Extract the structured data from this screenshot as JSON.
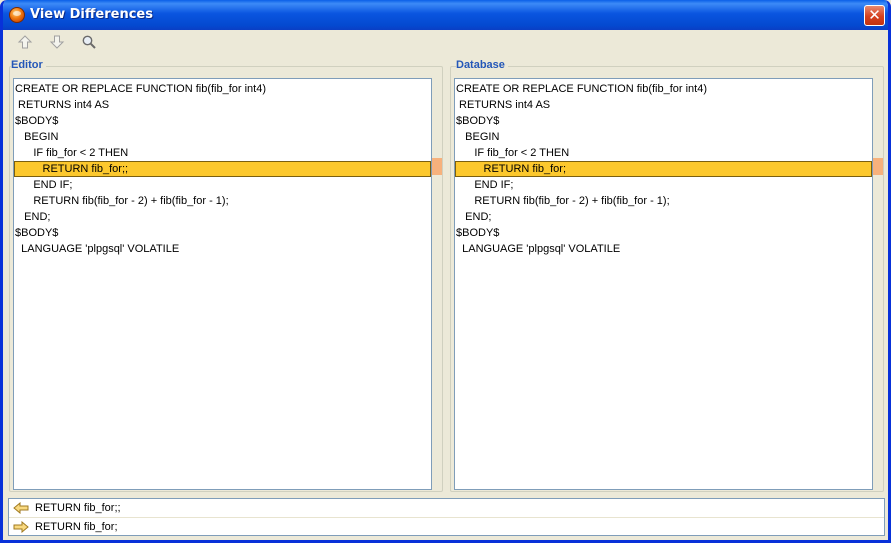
{
  "window": {
    "title": "View Differences",
    "close_label": "✕"
  },
  "toolbar": {
    "buttons": [
      {
        "name": "previous-difference-button",
        "icon": "arrow-up-icon"
      },
      {
        "name": "next-difference-button",
        "icon": "arrow-down-icon"
      },
      {
        "name": "find-button",
        "icon": "magnifier-icon"
      }
    ]
  },
  "editor": {
    "label": "Editor",
    "lines": [
      "CREATE OR REPLACE FUNCTION fib(fib_for int4)",
      " RETURNS int4 AS",
      "$BODY$",
      "   BEGIN",
      "      IF fib_for < 2 THEN",
      "         RETURN fib_for;;",
      "      END IF;",
      "      RETURN fib(fib_for - 2) + fib(fib_for - 1);",
      "   END;",
      "$BODY$",
      "  LANGUAGE 'plpgsql' VOLATILE"
    ]
  },
  "database": {
    "label": "Database",
    "lines": [
      "CREATE OR REPLACE FUNCTION fib(fib_for int4)",
      " RETURNS int4 AS",
      "$BODY$",
      "   BEGIN",
      "      IF fib_for < 2 THEN",
      "         RETURN fib_for;",
      "      END IF;",
      "      RETURN fib(fib_for - 2) + fib(fib_for - 1);",
      "   END;",
      "$BODY$",
      "  LANGUAGE 'plpgsql' VOLATILE"
    ]
  },
  "changes": [
    {
      "direction": "left",
      "text": "RETURN fib_for;;"
    },
    {
      "direction": "right",
      "text": "RETURN fib_for;"
    }
  ],
  "colors": {
    "diff_highlight": "#fcc82d",
    "overview_mark": "#f7b17c",
    "label_blue": "#2457b8",
    "arrow_fill": "#f9d980"
  }
}
